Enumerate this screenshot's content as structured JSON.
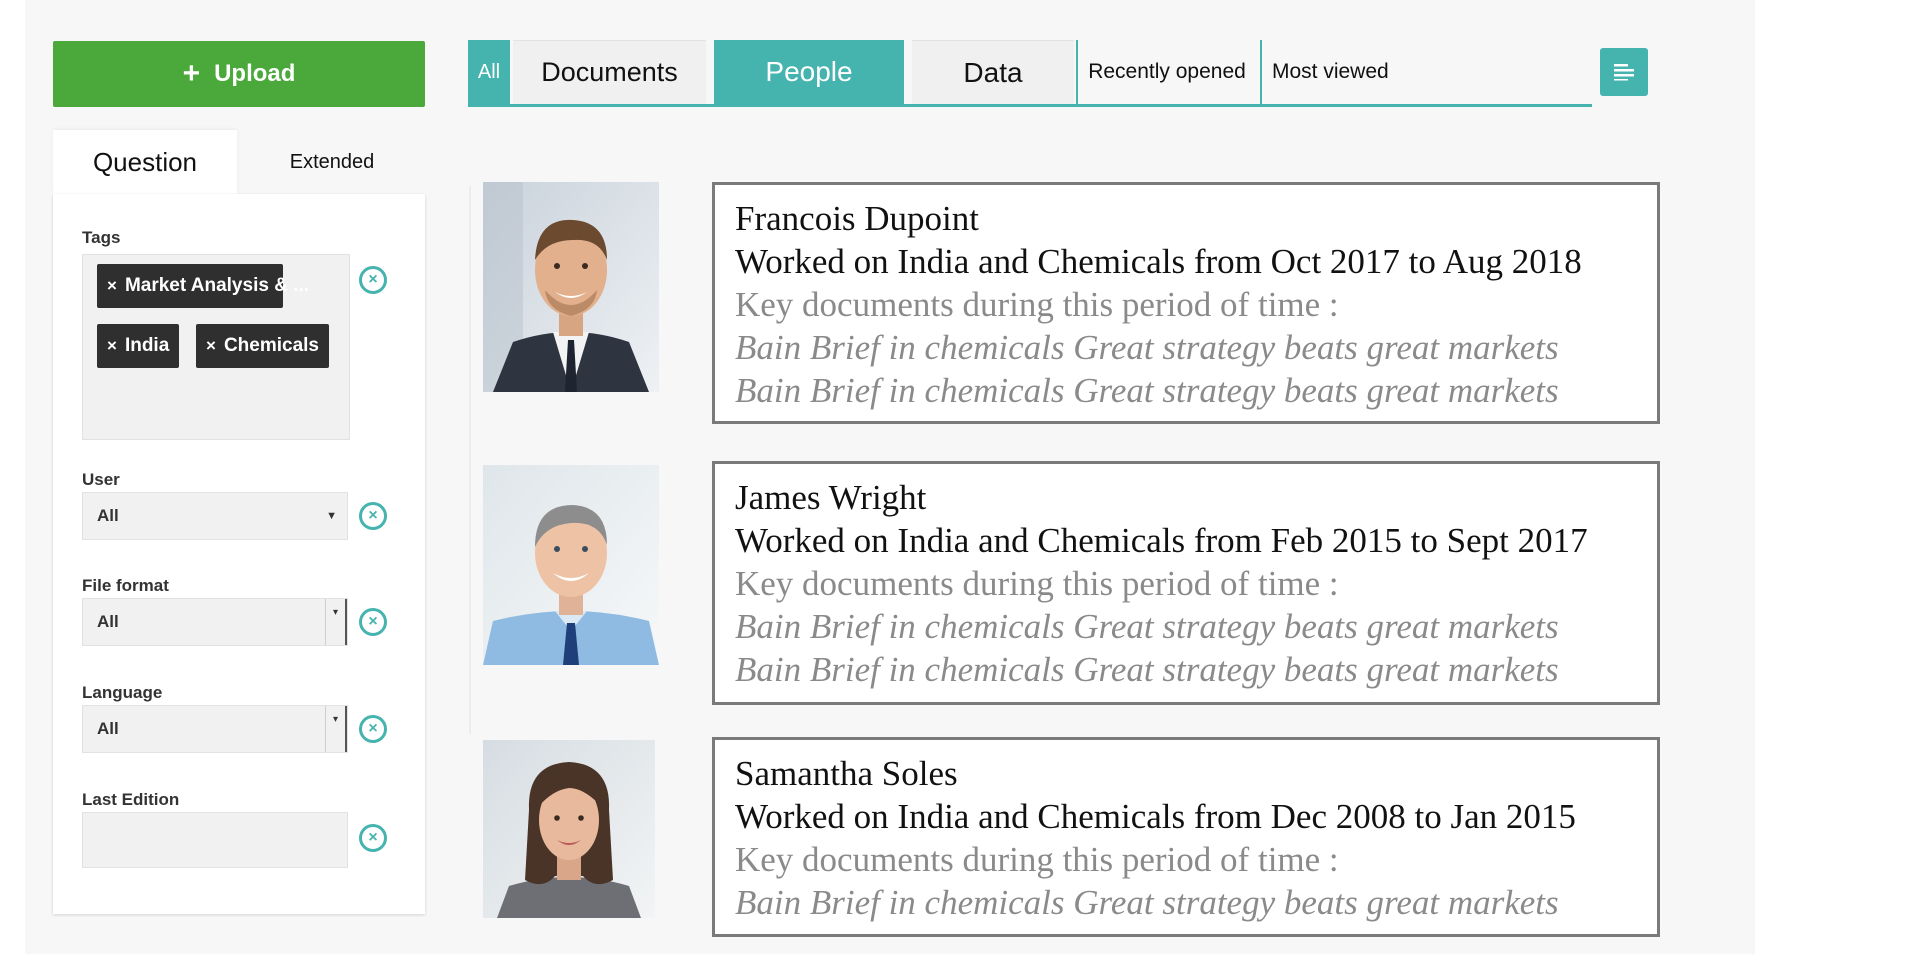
{
  "upload": {
    "plus": "+",
    "label": "Upload"
  },
  "filters": {
    "tabs": {
      "question": "Question",
      "extended": "Extended"
    },
    "tags_label": "Tags",
    "tags": [
      "Market Analysis & ...",
      "India",
      "Chemicals"
    ],
    "chip_remove": "×",
    "user_label": "User",
    "user_value": "All",
    "file_format_label": "File format",
    "file_format_value": "All",
    "language_label": "Language",
    "language_value": "All",
    "last_edition_label": "Last Edition",
    "last_edition_value": ""
  },
  "tabs": {
    "all": "All",
    "documents": "Documents",
    "people": "People",
    "data": "Data",
    "recently_opened": "Recently opened",
    "most_viewed": "Most viewed"
  },
  "colors": {
    "accent": "#45b3ae",
    "upload": "#4aa93a",
    "chip": "#2f2f2f"
  },
  "people": [
    {
      "name": "Francois Dupoint",
      "worked": "Worked on India and Chemicals from Oct 2017 to Aug 2018",
      "key_docs": "Key documents during this period of time :",
      "docs": [
        "Bain Brief in chemicals Great strategy beats great markets",
        "Bain Brief in chemicals Great strategy beats great markets"
      ]
    },
    {
      "name": "James Wright",
      "worked": "Worked on India and Chemicals from Feb 2015 to Sept 2017",
      "key_docs": "Key documents during this period of time :",
      "docs": [
        "Bain Brief in chemicals Great strategy beats great markets",
        "Bain Brief in chemicals Great strategy beats great markets"
      ]
    },
    {
      "name": "Samantha Soles",
      "worked": "Worked on India and Chemicals from Dec 2008 to Jan 2015",
      "key_docs": "Key documents during this period of time :",
      "docs": [
        "Bain Brief in chemicals Great strategy beats great markets"
      ]
    }
  ]
}
